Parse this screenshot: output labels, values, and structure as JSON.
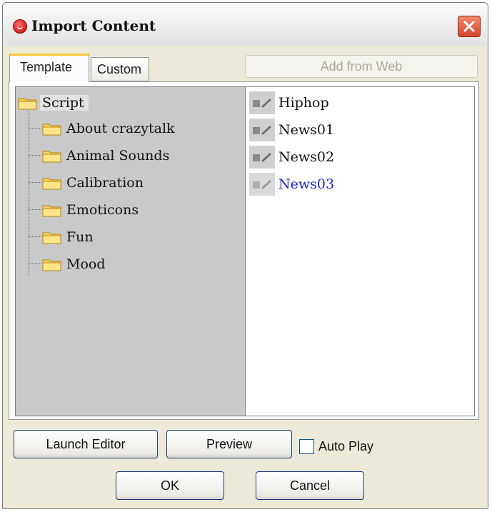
{
  "window": {
    "title": "Import Content"
  },
  "tabs": [
    {
      "label": "Template",
      "active": true
    },
    {
      "label": "Custom",
      "active": false
    }
  ],
  "toolbar": {
    "add_from_web_label": "Add from Web"
  },
  "tree": {
    "root": {
      "label": "Script",
      "icon": "folder-icon"
    },
    "children": [
      {
        "label": "About crazytalk",
        "icon": "folder-icon"
      },
      {
        "label": "Animal Sounds",
        "icon": "folder-icon"
      },
      {
        "label": "Calibration",
        "icon": "folder-icon"
      },
      {
        "label": "Emoticons",
        "icon": "folder-icon"
      },
      {
        "label": "Fun",
        "icon": "folder-icon"
      },
      {
        "label": "Mood",
        "icon": "folder-icon"
      }
    ]
  },
  "items": [
    {
      "label": "Hiphop",
      "icon": "script-icon"
    },
    {
      "label": "News01",
      "icon": "script-icon"
    },
    {
      "label": "News02",
      "icon": "script-icon"
    },
    {
      "label": "News03",
      "icon": "script-icon",
      "selected": true
    }
  ],
  "buttons": {
    "launch_editor": "Launch Editor",
    "preview": "Preview",
    "auto_play": "Auto Play",
    "ok": "OK",
    "cancel": "Cancel"
  },
  "colors": {
    "selected_text": "#1e1ecf",
    "close_button": "#d6462a",
    "title_icon": "#c00000"
  }
}
